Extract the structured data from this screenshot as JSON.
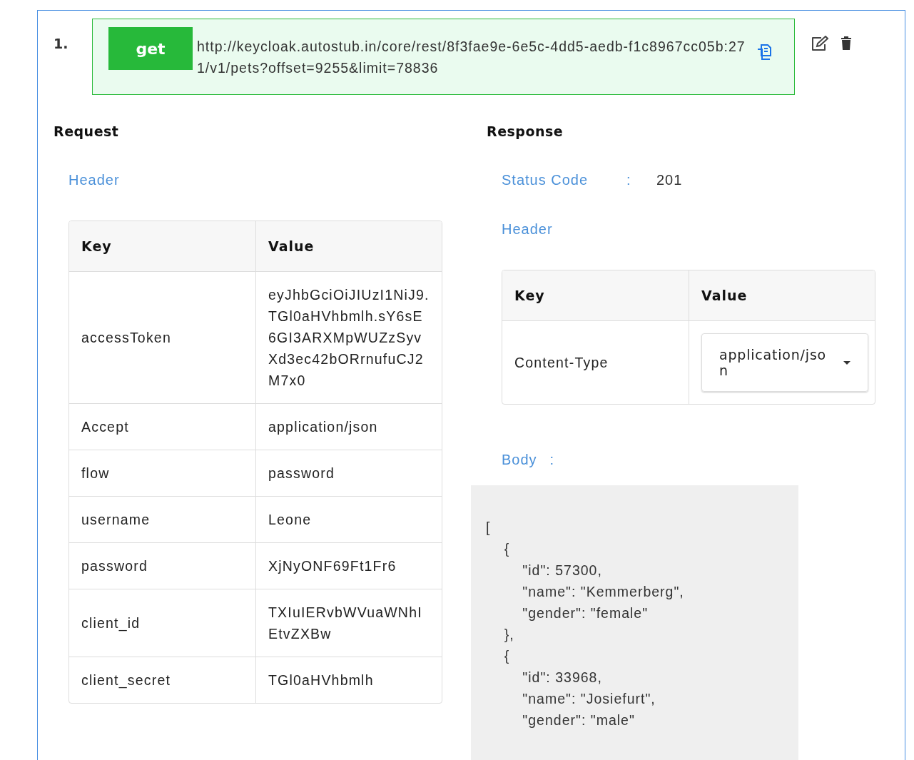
{
  "entry": {
    "number": "1.",
    "method": "get",
    "url": "http://keycloak.autostub.in/core/rest/8f3fae9e-6e5c-4dd5-aedb-f1c8967cc05b:271/v1/pets?offset=9255&limit=78836"
  },
  "request": {
    "title": "Request",
    "header_label": "Header",
    "table": {
      "columns": [
        "Key",
        "Value"
      ],
      "rows": [
        {
          "key": "accessToken",
          "value": "eyJhbGciOiJIUzI1NiJ9.TGl0aHVhbmlh.sY6sE6GI3ARXMpWUZzSyvXd3ec42bORrnufuCJ2M7x0"
        },
        {
          "key": "Accept",
          "value": "application/json"
        },
        {
          "key": "flow",
          "value": "password"
        },
        {
          "key": "username",
          "value": "Leone"
        },
        {
          "key": "password",
          "value": "XjNyONF69Ft1Fr6"
        },
        {
          "key": "client_id",
          "value": "TXIuIERvbWVuaWNhIEtvZXBw"
        },
        {
          "key": "client_secret",
          "value": "TGl0aHVhbmlh"
        }
      ]
    }
  },
  "response": {
    "title": "Response",
    "status_label": "Status Code",
    "status_sep": ":",
    "status_code": "201",
    "header_label": "Header",
    "table": {
      "columns": [
        "Key",
        "Value"
      ],
      "rows": [
        {
          "key": "Content-Type",
          "value": "application/json",
          "kind": "dropdown"
        }
      ]
    },
    "body_label": "Body",
    "body_sep": ":",
    "body": "[\n    {\n        \"id\": 57300,\n        \"name\": \"Kemmerberg\",\n        \"gender\": \"female\"\n    },\n    {\n        \"id\": 33968,\n        \"name\": \"Josiefurt\",\n        \"gender\": \"male\""
  }
}
